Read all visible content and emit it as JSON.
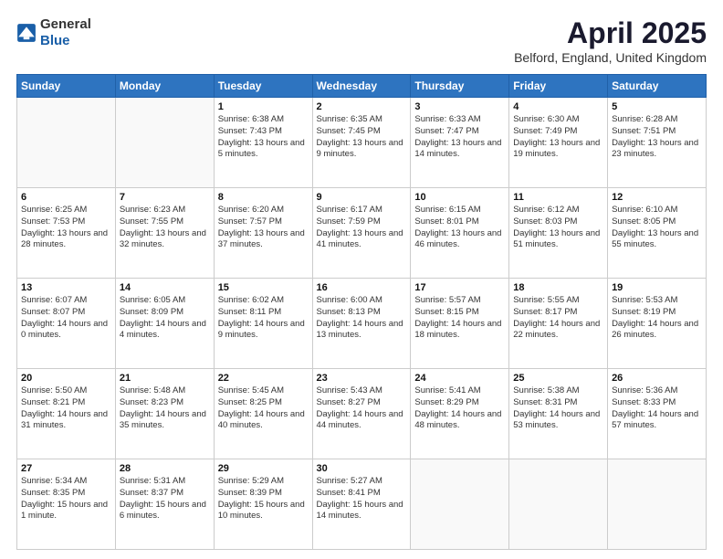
{
  "header": {
    "logo_general": "General",
    "logo_blue": "Blue",
    "title": "April 2025",
    "location": "Belford, England, United Kingdom"
  },
  "days_of_week": [
    "Sunday",
    "Monday",
    "Tuesday",
    "Wednesday",
    "Thursday",
    "Friday",
    "Saturday"
  ],
  "weeks": [
    [
      {
        "day": "",
        "info": ""
      },
      {
        "day": "",
        "info": ""
      },
      {
        "day": "1",
        "info": "Sunrise: 6:38 AM\nSunset: 7:43 PM\nDaylight: 13 hours and 5 minutes."
      },
      {
        "day": "2",
        "info": "Sunrise: 6:35 AM\nSunset: 7:45 PM\nDaylight: 13 hours and 9 minutes."
      },
      {
        "day": "3",
        "info": "Sunrise: 6:33 AM\nSunset: 7:47 PM\nDaylight: 13 hours and 14 minutes."
      },
      {
        "day": "4",
        "info": "Sunrise: 6:30 AM\nSunset: 7:49 PM\nDaylight: 13 hours and 19 minutes."
      },
      {
        "day": "5",
        "info": "Sunrise: 6:28 AM\nSunset: 7:51 PM\nDaylight: 13 hours and 23 minutes."
      }
    ],
    [
      {
        "day": "6",
        "info": "Sunrise: 6:25 AM\nSunset: 7:53 PM\nDaylight: 13 hours and 28 minutes."
      },
      {
        "day": "7",
        "info": "Sunrise: 6:23 AM\nSunset: 7:55 PM\nDaylight: 13 hours and 32 minutes."
      },
      {
        "day": "8",
        "info": "Sunrise: 6:20 AM\nSunset: 7:57 PM\nDaylight: 13 hours and 37 minutes."
      },
      {
        "day": "9",
        "info": "Sunrise: 6:17 AM\nSunset: 7:59 PM\nDaylight: 13 hours and 41 minutes."
      },
      {
        "day": "10",
        "info": "Sunrise: 6:15 AM\nSunset: 8:01 PM\nDaylight: 13 hours and 46 minutes."
      },
      {
        "day": "11",
        "info": "Sunrise: 6:12 AM\nSunset: 8:03 PM\nDaylight: 13 hours and 51 minutes."
      },
      {
        "day": "12",
        "info": "Sunrise: 6:10 AM\nSunset: 8:05 PM\nDaylight: 13 hours and 55 minutes."
      }
    ],
    [
      {
        "day": "13",
        "info": "Sunrise: 6:07 AM\nSunset: 8:07 PM\nDaylight: 14 hours and 0 minutes."
      },
      {
        "day": "14",
        "info": "Sunrise: 6:05 AM\nSunset: 8:09 PM\nDaylight: 14 hours and 4 minutes."
      },
      {
        "day": "15",
        "info": "Sunrise: 6:02 AM\nSunset: 8:11 PM\nDaylight: 14 hours and 9 minutes."
      },
      {
        "day": "16",
        "info": "Sunrise: 6:00 AM\nSunset: 8:13 PM\nDaylight: 14 hours and 13 minutes."
      },
      {
        "day": "17",
        "info": "Sunrise: 5:57 AM\nSunset: 8:15 PM\nDaylight: 14 hours and 18 minutes."
      },
      {
        "day": "18",
        "info": "Sunrise: 5:55 AM\nSunset: 8:17 PM\nDaylight: 14 hours and 22 minutes."
      },
      {
        "day": "19",
        "info": "Sunrise: 5:53 AM\nSunset: 8:19 PM\nDaylight: 14 hours and 26 minutes."
      }
    ],
    [
      {
        "day": "20",
        "info": "Sunrise: 5:50 AM\nSunset: 8:21 PM\nDaylight: 14 hours and 31 minutes."
      },
      {
        "day": "21",
        "info": "Sunrise: 5:48 AM\nSunset: 8:23 PM\nDaylight: 14 hours and 35 minutes."
      },
      {
        "day": "22",
        "info": "Sunrise: 5:45 AM\nSunset: 8:25 PM\nDaylight: 14 hours and 40 minutes."
      },
      {
        "day": "23",
        "info": "Sunrise: 5:43 AM\nSunset: 8:27 PM\nDaylight: 14 hours and 44 minutes."
      },
      {
        "day": "24",
        "info": "Sunrise: 5:41 AM\nSunset: 8:29 PM\nDaylight: 14 hours and 48 minutes."
      },
      {
        "day": "25",
        "info": "Sunrise: 5:38 AM\nSunset: 8:31 PM\nDaylight: 14 hours and 53 minutes."
      },
      {
        "day": "26",
        "info": "Sunrise: 5:36 AM\nSunset: 8:33 PM\nDaylight: 14 hours and 57 minutes."
      }
    ],
    [
      {
        "day": "27",
        "info": "Sunrise: 5:34 AM\nSunset: 8:35 PM\nDaylight: 15 hours and 1 minute."
      },
      {
        "day": "28",
        "info": "Sunrise: 5:31 AM\nSunset: 8:37 PM\nDaylight: 15 hours and 6 minutes."
      },
      {
        "day": "29",
        "info": "Sunrise: 5:29 AM\nSunset: 8:39 PM\nDaylight: 15 hours and 10 minutes."
      },
      {
        "day": "30",
        "info": "Sunrise: 5:27 AM\nSunset: 8:41 PM\nDaylight: 15 hours and 14 minutes."
      },
      {
        "day": "",
        "info": ""
      },
      {
        "day": "",
        "info": ""
      },
      {
        "day": "",
        "info": ""
      }
    ]
  ]
}
